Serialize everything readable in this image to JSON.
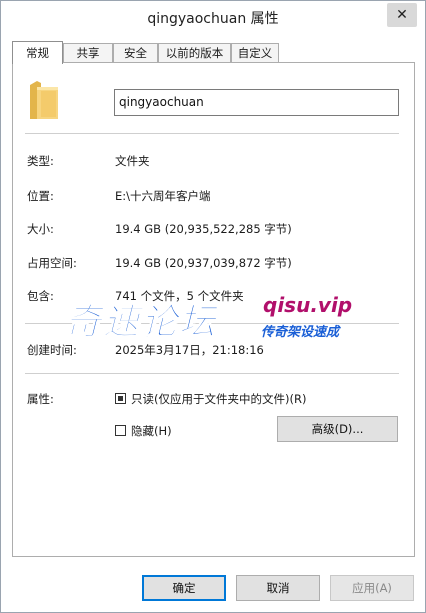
{
  "window": {
    "title": "qingyaochuan 属性",
    "close_symbol": "✕"
  },
  "tabs": [
    {
      "label": "常规",
      "active": true
    },
    {
      "label": "共享",
      "active": false
    },
    {
      "label": "安全",
      "active": false
    },
    {
      "label": "以前的版本",
      "active": false
    },
    {
      "label": "自定义",
      "active": false
    }
  ],
  "general": {
    "folder_name": "qingyaochuan",
    "folder_icon": "folder-icon",
    "rows": [
      {
        "label": "类型:",
        "value": "文件夹"
      },
      {
        "label": "位置:",
        "value": "E:\\十六周年客户端"
      },
      {
        "label": "大小:",
        "value": "19.4 GB (20,935,522,285 字节)"
      },
      {
        "label": "占用空间:",
        "value": "19.4 GB (20,937,039,872 字节)"
      },
      {
        "label": "包含:",
        "value": "741 个文件，5 个文件夹"
      },
      {
        "label": "创建时间:",
        "value": "2025年3月17日，21:18:16"
      }
    ],
    "attributes": {
      "label": "属性:",
      "readonly_label": "只读(仅应用于文件夹中的文件)(R)",
      "readonly_state": "indeterminate",
      "hidden_label": "隐藏(H)",
      "hidden_state": "unchecked",
      "advanced_button": "高级(D)..."
    }
  },
  "watermark": {
    "main": "奇速论坛",
    "site": "qisu.vip",
    "sub": "传奇架设速成"
  },
  "footer": {
    "ok": "确定",
    "cancel": "取消",
    "apply": "应用(A)"
  },
  "colors": {
    "default_button_border": "#0078d7",
    "watermark_blue": "#1a5fd6",
    "watermark_magenta": "#b10f6b"
  }
}
